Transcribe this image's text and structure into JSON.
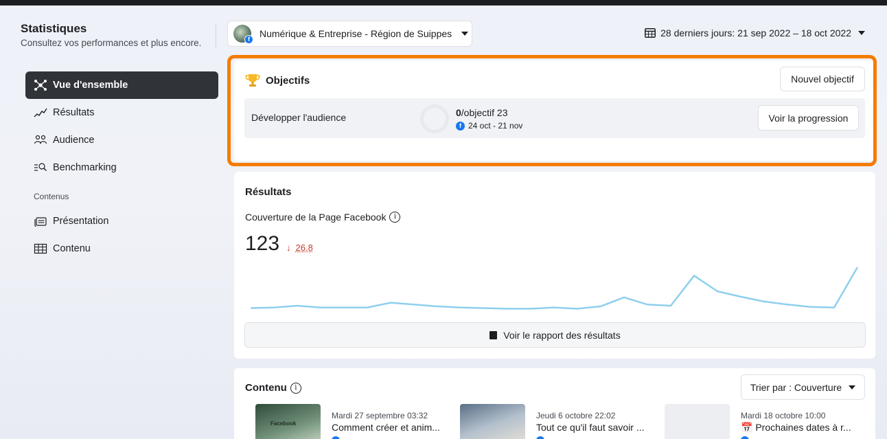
{
  "header": {
    "title": "Statistiques",
    "subtitle": "Consultez vos performances et plus encore.",
    "page_select": "Numérique & Entreprise - Région de Suippes",
    "date_range": "28 derniers jours: 21 sep 2022 – 18 oct 2022"
  },
  "sidebar": {
    "items": [
      {
        "label": "Vue d'ensemble",
        "icon": "overview-icon"
      },
      {
        "label": "Résultats",
        "icon": "trend-icon"
      },
      {
        "label": "Audience",
        "icon": "people-icon"
      },
      {
        "label": "Benchmarking",
        "icon": "benchmark-icon"
      }
    ],
    "section": "Contenus",
    "section_items": [
      {
        "label": "Présentation",
        "icon": "presentation-icon"
      },
      {
        "label": "Contenu",
        "icon": "table-icon"
      }
    ]
  },
  "goals": {
    "title": "Objectifs",
    "new_goal_label": "Nouvel objectif",
    "goal_name": "Développer l'audience",
    "progress_current": "0",
    "progress_rest": "/objectif 23",
    "dates": "24 oct - 21 nov",
    "view_progress_label": "Voir la progression",
    "accent_color": "#f57c00"
  },
  "results": {
    "title": "Résultats",
    "metric_label": "Couverture de la Page Facebook",
    "metric_value": "123",
    "delta_arrow": "↓",
    "delta_value": "26,8",
    "report_label": "Voir le rapport des résultats"
  },
  "chart_data": {
    "type": "line",
    "values": [
      4,
      5,
      8,
      5,
      5,
      5,
      13,
      10,
      7,
      5,
      4,
      3,
      3,
      5,
      3,
      7,
      22,
      10,
      8,
      58,
      32,
      23,
      15,
      10,
      6,
      5,
      72
    ],
    "ylim": [
      0,
      80
    ],
    "color": "#8ecfee"
  },
  "content": {
    "title": "Contenu",
    "sort_label": "Trier par : Couverture",
    "posts": [
      {
        "date": "Mardi 27 septembre 03:32",
        "title": "Comment créer et anim...",
        "thumb_text": "Facebook"
      },
      {
        "date": "Jeudi 6 octobre 22:02",
        "title": "Tout ce qu'il faut savoir ..."
      },
      {
        "date": "Mardi 18 octobre 10:00",
        "title": "📅 Prochaines dates à r..."
      }
    ]
  }
}
